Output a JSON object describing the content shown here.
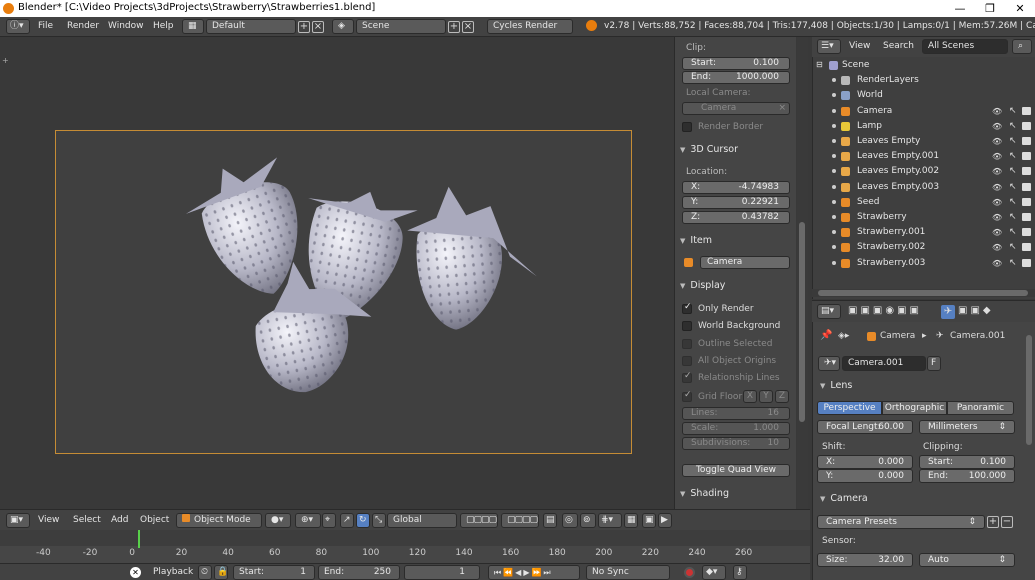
{
  "window": {
    "title": "Blender* [C:\\Video Projects\\3dProjects\\Strawberry\\Strawberries1.blend]",
    "minimize": "—",
    "maximize": "❐",
    "close": "✕"
  },
  "info_header": {
    "menus": [
      "File",
      "Render",
      "Window",
      "Help"
    ],
    "layout": "Default",
    "scene": "Scene",
    "engine": "Cycles Render",
    "stats": "v2.78 | Verts:88,752 | Faces:88,704 | Tris:177,408 | Objects:1/30 | Lamps:0/1 | Mem:57.26M | Camera"
  },
  "n_panel": {
    "clip_label": "Clip:",
    "clip_start_label": "Start:",
    "clip_start": "0.100",
    "clip_end_label": "End:",
    "clip_end": "1000.000",
    "local_camera_label": "Local Camera:",
    "local_camera": "Camera",
    "render_border": "Render Border",
    "cursor_section": "3D Cursor",
    "location_label": "Location:",
    "cursor_x_label": "X:",
    "cursor_x": "-4.74983",
    "cursor_y_label": "Y:",
    "cursor_y": "0.22921",
    "cursor_z_label": "Z:",
    "cursor_z": "0.43782",
    "item_section": "Item",
    "item_name": "Camera",
    "display_section": "Display",
    "only_render": "Only Render",
    "world_background": "World Background",
    "outline_selected": "Outline Selected",
    "all_object_origins": "All Object Origins",
    "relationship_lines": "Relationship Lines",
    "grid_floor": "Grid Floor",
    "grid_x": "X",
    "grid_y": "Y",
    "grid_z": "Z",
    "lines_label": "Lines:",
    "lines": "16",
    "scale_label": "Scale:",
    "scale": "1.000",
    "subdiv_label": "Subdivisions:",
    "subdiv": "10",
    "toggle_quad": "Toggle Quad View",
    "shading_section": "Shading"
  },
  "outliner": {
    "view_menu": "View",
    "search_menu": "Search",
    "filter": "All Scenes",
    "items": [
      {
        "name": "Scene",
        "color": "#a0a0d0"
      },
      {
        "name": "RenderLayers",
        "color": "#b8b8b8"
      },
      {
        "name": "World",
        "color": "#8aa0c8"
      },
      {
        "name": "Camera",
        "color": "#e88b28"
      },
      {
        "name": "Lamp",
        "color": "#e8c838"
      },
      {
        "name": "Leaves Empty",
        "color": "#e8a848"
      },
      {
        "name": "Leaves Empty.001",
        "color": "#e8a848"
      },
      {
        "name": "Leaves Empty.002",
        "color": "#e8a848"
      },
      {
        "name": "Leaves Empty.003",
        "color": "#e8a848"
      },
      {
        "name": "Seed",
        "color": "#e88b28"
      },
      {
        "name": "Strawberry",
        "color": "#e88b28"
      },
      {
        "name": "Strawberry.001",
        "color": "#e88b28"
      },
      {
        "name": "Strawberry.002",
        "color": "#e88b28"
      },
      {
        "name": "Strawberry.003",
        "color": "#e88b28"
      }
    ]
  },
  "properties": {
    "breadcrumb_object": "Camera",
    "breadcrumb_data": "Camera.001",
    "datablock": "Camera.001",
    "fake_user": "F",
    "lens_section": "Lens",
    "lens_types": [
      "Perspective",
      "Orthographic",
      "Panoramic"
    ],
    "focal_label": "Focal Lengt:",
    "focal": "60.00",
    "lens_unit": "Millimeters",
    "shift_label": "Shift:",
    "shift_x_label": "X:",
    "shift_x": "0.000",
    "shift_y_label": "Y:",
    "shift_y": "0.000",
    "clipping_label": "Clipping:",
    "clip_start_label": "Start:",
    "clip_start": "0.100",
    "clip_end_label": "End:",
    "clip_end": "100.000",
    "camera_section": "Camera",
    "presets": "Camera Presets",
    "sensor_label": "Sensor:",
    "sensor_size_label": "Size:",
    "sensor_size": "32.00",
    "sensor_fit": "Auto"
  },
  "view3d_header": {
    "menus": [
      "View",
      "Select",
      "Add",
      "Object"
    ],
    "mode": "Object Mode",
    "orientation": "Global"
  },
  "timeline": {
    "ticks": [
      "-40",
      "-20",
      "0",
      "20",
      "40",
      "60",
      "80",
      "100",
      "120",
      "140",
      "160",
      "180",
      "200",
      "220",
      "240",
      "260"
    ],
    "current_frame": "1",
    "playback": "Playback",
    "start_label": "Start:",
    "start": "1",
    "end_label": "End:",
    "end": "250",
    "sync": "No Sync"
  },
  "colors": {
    "accent_blue": "#5680c2",
    "camera_frame": "#c58c35",
    "current_frame": "#58d04a"
  }
}
